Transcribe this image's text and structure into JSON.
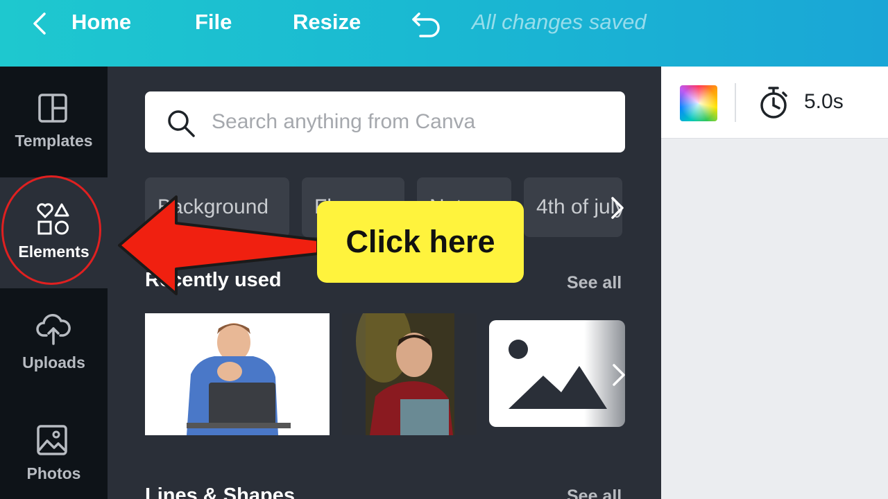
{
  "topbar": {
    "home": "Home",
    "file": "File",
    "resize": "Resize",
    "status": "All changes saved",
    "colors": {
      "gradient_start": "#1ec8cf",
      "gradient_end": "#1aa6d6"
    }
  },
  "sidebar": {
    "items": [
      {
        "label": "Templates",
        "icon": "templates-icon"
      },
      {
        "label": "Elements",
        "icon": "elements-icon",
        "active": true
      },
      {
        "label": "Uploads",
        "icon": "upload-cloud-icon"
      },
      {
        "label": "Photos",
        "icon": "image-icon"
      }
    ]
  },
  "search": {
    "placeholder": "Search anything from Canva",
    "value": ""
  },
  "chips": [
    "Background",
    "Flowers",
    "Nature",
    "4th of july"
  ],
  "sections": {
    "recent": {
      "title": "Recently used",
      "see_all": "See all"
    },
    "lines": {
      "title": "Lines & Shapes",
      "see_all": "See all"
    }
  },
  "toolbar": {
    "duration": "5.0s"
  },
  "annotation": {
    "callout": "Click here",
    "color": "#e02020",
    "callout_bg": "#fff33d"
  }
}
